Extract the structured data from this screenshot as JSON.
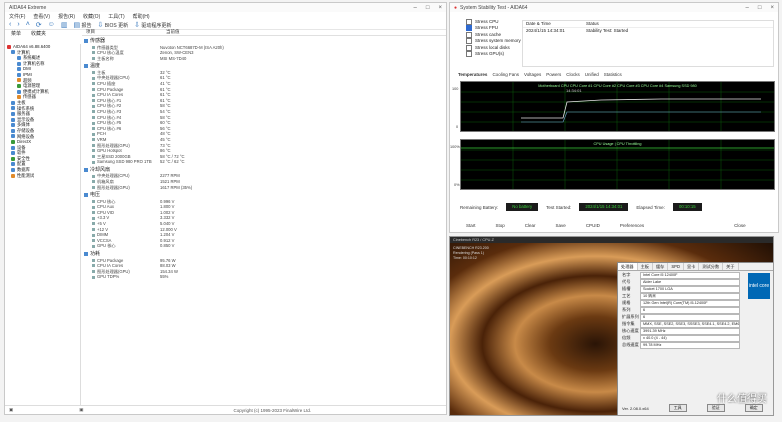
{
  "aida": {
    "title": "AIDA64 Extreme",
    "menu": [
      "文件(F)",
      "查看(V)",
      "报告(R)",
      "收藏(O)",
      "工具(T)",
      "帮助(H)"
    ],
    "toolbar": {
      "report": "报告",
      "bios": "BIOS 更新",
      "driver": "驱动程序更新"
    },
    "left_tabs": [
      "菜单",
      "收藏夹"
    ],
    "columns": [
      "项目",
      "当前值"
    ],
    "tree": [
      {
        "label": "AIDA64 v6.88.6400",
        "color": "#d33"
      },
      {
        "label": "计算机",
        "color": "#4a8ad0"
      },
      {
        "label": "系统概述",
        "color": "#4a8ad0"
      },
      {
        "label": "计算机名称",
        "color": "#4a8ad0"
      },
      {
        "label": "DMI",
        "color": "#4a8ad0"
      },
      {
        "label": "IPMI",
        "color": "#4a8ad0"
      },
      {
        "label": "超频",
        "color": "#e08a2a"
      },
      {
        "label": "电源管理",
        "color": "#3a9a3a"
      },
      {
        "label": "便携式计算机",
        "color": "#4a8ad0"
      },
      {
        "label": "传感器",
        "color": "#e08a2a"
      },
      {
        "label": "主板",
        "color": "#4a8ad0"
      },
      {
        "label": "操作系统",
        "color": "#4a8ad0"
      },
      {
        "label": "服务器",
        "color": "#4a8ad0"
      },
      {
        "label": "显示设备",
        "color": "#4a8ad0"
      },
      {
        "label": "多媒体",
        "color": "#4a8ad0"
      },
      {
        "label": "存储设备",
        "color": "#4a8ad0"
      },
      {
        "label": "网络设备",
        "color": "#4a8ad0"
      },
      {
        "label": "DirectX",
        "color": "#3a9a3a"
      },
      {
        "label": "设备",
        "color": "#4a8ad0"
      },
      {
        "label": "软件",
        "color": "#4a8ad0"
      },
      {
        "label": "安全性",
        "color": "#3a9a3a"
      },
      {
        "label": "配置",
        "color": "#4a8ad0"
      },
      {
        "label": "数据库",
        "color": "#4a8ad0"
      },
      {
        "label": "性能测试",
        "color": "#e08a2a"
      }
    ],
    "groups": [
      {
        "name": "传感器",
        "rows": [
          {
            "k": "传感器类型",
            "v": "Nuvoton NCT6687D-M (ISA A20h)"
          },
          {
            "k": "CPU 核心温度",
            "v": "Zenon, SW-CEN3"
          },
          {
            "k": "主板名称",
            "v": "MSI MS-7D40"
          }
        ]
      },
      {
        "name": "温度",
        "rows": [
          {
            "k": "主板",
            "v": "32 °C"
          },
          {
            "k": "中央处理器(CPU)",
            "v": "61 °C"
          },
          {
            "k": "CPU 插座",
            "v": "41 °C"
          },
          {
            "k": "CPU Package",
            "v": "61 °C"
          },
          {
            "k": "CPU IA Cores",
            "v": "61 °C"
          },
          {
            "k": "CPU 核心 #1",
            "v": "61 °C"
          },
          {
            "k": "CPU 核心 #2",
            "v": "58 °C"
          },
          {
            "k": "CPU 核心 #3",
            "v": "54 °C"
          },
          {
            "k": "CPU 核心 #4",
            "v": "58 °C"
          },
          {
            "k": "CPU 核心 #5",
            "v": "60 °C"
          },
          {
            "k": "CPU 核心 #6",
            "v": "56 °C"
          },
          {
            "k": "PCH",
            "v": "48 °C"
          },
          {
            "k": "VRM",
            "v": "45 °C"
          },
          {
            "k": "图形处理器(GPU)",
            "v": "73 °C"
          },
          {
            "k": "GPU Hotspot",
            "v": "86 °C"
          },
          {
            "k": "三星SSD 2000GB",
            "v": "58 °C / 72 °C"
          },
          {
            "k": "Samsung SSD 980 PRO 1TB",
            "v": "52 °C / 62 °C"
          }
        ]
      },
      {
        "name": "冷却风扇",
        "rows": [
          {
            "k": "中央处理器(CPU)",
            "v": "2277 RPM"
          },
          {
            "k": "机箱风扇",
            "v": "1521 RPM"
          },
          {
            "k": "图形处理器(GPU)",
            "v": "1617 RPM (35%)"
          }
        ]
      },
      {
        "name": "电压",
        "rows": [
          {
            "k": "CPU 核心",
            "v": "0.996 V"
          },
          {
            "k": "CPU Aux",
            "v": "1.800 V"
          },
          {
            "k": "CPU VID",
            "v": "1.002 V"
          },
          {
            "k": "+3.3 V",
            "v": "3.332 V"
          },
          {
            "k": "+5 V",
            "v": "5.040 V"
          },
          {
            "k": "+12 V",
            "v": "12.000 V"
          },
          {
            "k": "DIMM",
            "v": "1.204 V"
          },
          {
            "k": "VCCSA",
            "v": "0.912 V"
          },
          {
            "k": "GPU 核心",
            "v": "0.850 V"
          }
        ]
      },
      {
        "name": "功耗",
        "rows": [
          {
            "k": "CPU Package",
            "v": "95.76 W"
          },
          {
            "k": "CPU IA Cores",
            "v": "88.03 W"
          },
          {
            "k": "图形处理器(GPU)",
            "v": "154.34 W"
          },
          {
            "k": "GPU TDP%",
            "v": "55%"
          }
        ]
      }
    ],
    "copyright": "Copyright (c) 1995-2023 FinalWire Ltd."
  },
  "stability": {
    "title": "System Stability Test - AIDA64",
    "checks": [
      {
        "label": "Stress CPU",
        "on": false
      },
      {
        "label": "Stress FPU",
        "on": true
      },
      {
        "label": "Stress cache",
        "on": false
      },
      {
        "label": "Stress system memory",
        "on": false
      },
      {
        "label": "Stress local disks",
        "on": false
      },
      {
        "label": "Stress GPU(s)",
        "on": false
      }
    ],
    "table_header": [
      "Date & Time",
      "Status"
    ],
    "table_rows": [
      [
        "2024/1/15 14:34:01",
        "Stability Test: Started"
      ]
    ],
    "graph_tabs": [
      "Temperatures",
      "Cooling Fans",
      "Voltages",
      "Powers",
      "Clocks",
      "Unified",
      "Statistics"
    ],
    "graph1_legend": "Motherboard  CPU  CPU Core #1  CPU Core #2  CPU Core #3  CPU Core #4  Samsung SSD 980",
    "graph1_y": [
      "100",
      "0"
    ],
    "graph1_time": "14:34:01",
    "graph2_legend": "CPU Usage | CPU Throttling",
    "graph2_y": [
      "100%",
      "0%"
    ],
    "remaining_battery_label": "Remaining Battery:",
    "remaining_battery": "No battery",
    "test_started_label": "Test Started:",
    "test_started": "2024/1/15 14:34:01",
    "elapsed_label": "Elapsed Time:",
    "elapsed": "00:10:15",
    "buttons": [
      "Start",
      "Stop",
      "Clear",
      "Save",
      "CPUID",
      "Preferences",
      "Close"
    ]
  },
  "cpuz": {
    "title": "Cinebench R23 / CPU-Z",
    "overlay_text": [
      "CINEBENCH R23.200",
      "Rendering (Pass 1)",
      "Time: 00:10:12"
    ],
    "tabs": [
      "处理器",
      "主板",
      "缓存",
      "SPD",
      "显卡",
      "测试分数",
      "关于"
    ],
    "fields": [
      {
        "lab": "名字",
        "v": "Intel Core i5 12400F"
      },
      {
        "lab": "代号",
        "v": "Alder Lake"
      },
      {
        "lab": "插槽",
        "v": "Socket 1700 LGA"
      },
      {
        "lab": "工艺",
        "v": "10 纳米"
      },
      {
        "lab": "规格",
        "v": "12th Gen Intel(R) Core(TM) i5-12400F"
      },
      {
        "lab": "系列",
        "v": "6"
      },
      {
        "lab": "扩展系列",
        "v": "6"
      },
      {
        "lab": "指令集",
        "v": "MMX, SSE, SSE2, SSE3, SSSE3, SSE4.1, SSE4.2, EM64T, VT-x, AES, AVX, AVX2, FMA3, SHA"
      },
      {
        "lab": "核心速度",
        "v": "3991.39 MHz"
      },
      {
        "lab": "倍频",
        "v": "x 40.0 (4 - 44)"
      },
      {
        "lab": "总线速度",
        "v": "99.78 MHz"
      }
    ],
    "logo": "intel core",
    "version": "Ver. 2.08.0.x64",
    "tools_label": "工具",
    "validate_label": "验证",
    "ok_label": "确定",
    "watermark": "什么值得买"
  }
}
